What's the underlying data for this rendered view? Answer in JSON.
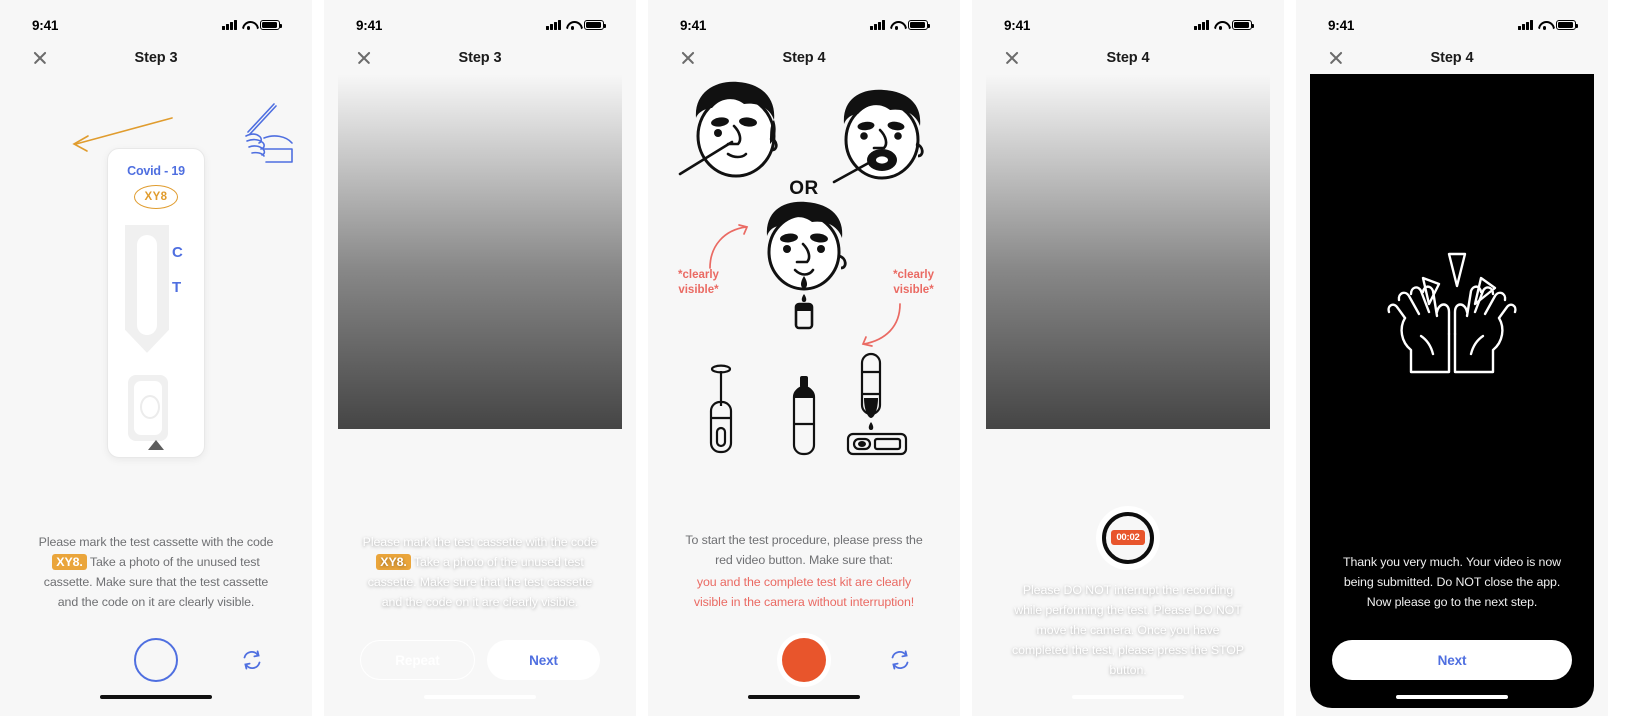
{
  "common": {
    "status_time": "9:41",
    "close_icon": "close-icon",
    "signal_icon": "cellular-signal-icon",
    "wifi_icon": "wifi-icon",
    "battery_icon": "battery-icon"
  },
  "screens": [
    {
      "id": "step3-instruction",
      "title": "Step 3",
      "cassette": {
        "brand_label": "Covid - 19",
        "code": "XY8",
        "control_mark": "C",
        "test_mark": "T"
      },
      "caption": {
        "part1": "Please mark the test cassette with the code ",
        "highlight": "XY8.",
        "part2": " Take a photo of the unused test cassette. Make sure that the test cassette and the code on it are clearly visible."
      },
      "shutter_label": "",
      "flip_icon": "camera-flip-icon"
    },
    {
      "id": "step3-review",
      "title": "Step 3",
      "caption": {
        "part1": "Please mark the test cassette with the code ",
        "highlight": "XY8.",
        "part2": " Take a photo of the unused test cassette. Make sure that the test cassette and the code on it are clearly visible."
      },
      "buttons": {
        "repeat": "Repeat",
        "next": "Next"
      }
    },
    {
      "id": "step4-instruction",
      "title": "Step 4",
      "illustration": {
        "or_label": "OR",
        "annotation_left": "*clearly\nvisible*",
        "annotation_right": "*clearly\nvisible*"
      },
      "caption": {
        "grey": "To start the test procedure, please press the red video button. Make sure that:",
        "red": "you and the complete test kit are clearly visible in the camera without interruption!"
      },
      "record_button": "record-button",
      "flip_icon": "camera-flip-icon"
    },
    {
      "id": "step4-recording",
      "title": "Step 4",
      "timer": "00:02",
      "caption": "Please DO NOT interrupt the recording while performing the test. Please DO NOT move the camera. Once you have completed the test, please press the STOP button."
    },
    {
      "id": "step4-submitted",
      "title": "Step 4",
      "caption": "Thank you very much. Your video is now being submitted. Do NOT close the app. Now please go to the next step.",
      "buttons": {
        "next": "Next"
      }
    }
  ],
  "colors": {
    "accent_blue": "#4f6fe0",
    "accent_orange": "#eaa53b",
    "record_red": "#e8552c",
    "warn_red": "#ea6a63",
    "body_text": "#6f7073"
  }
}
